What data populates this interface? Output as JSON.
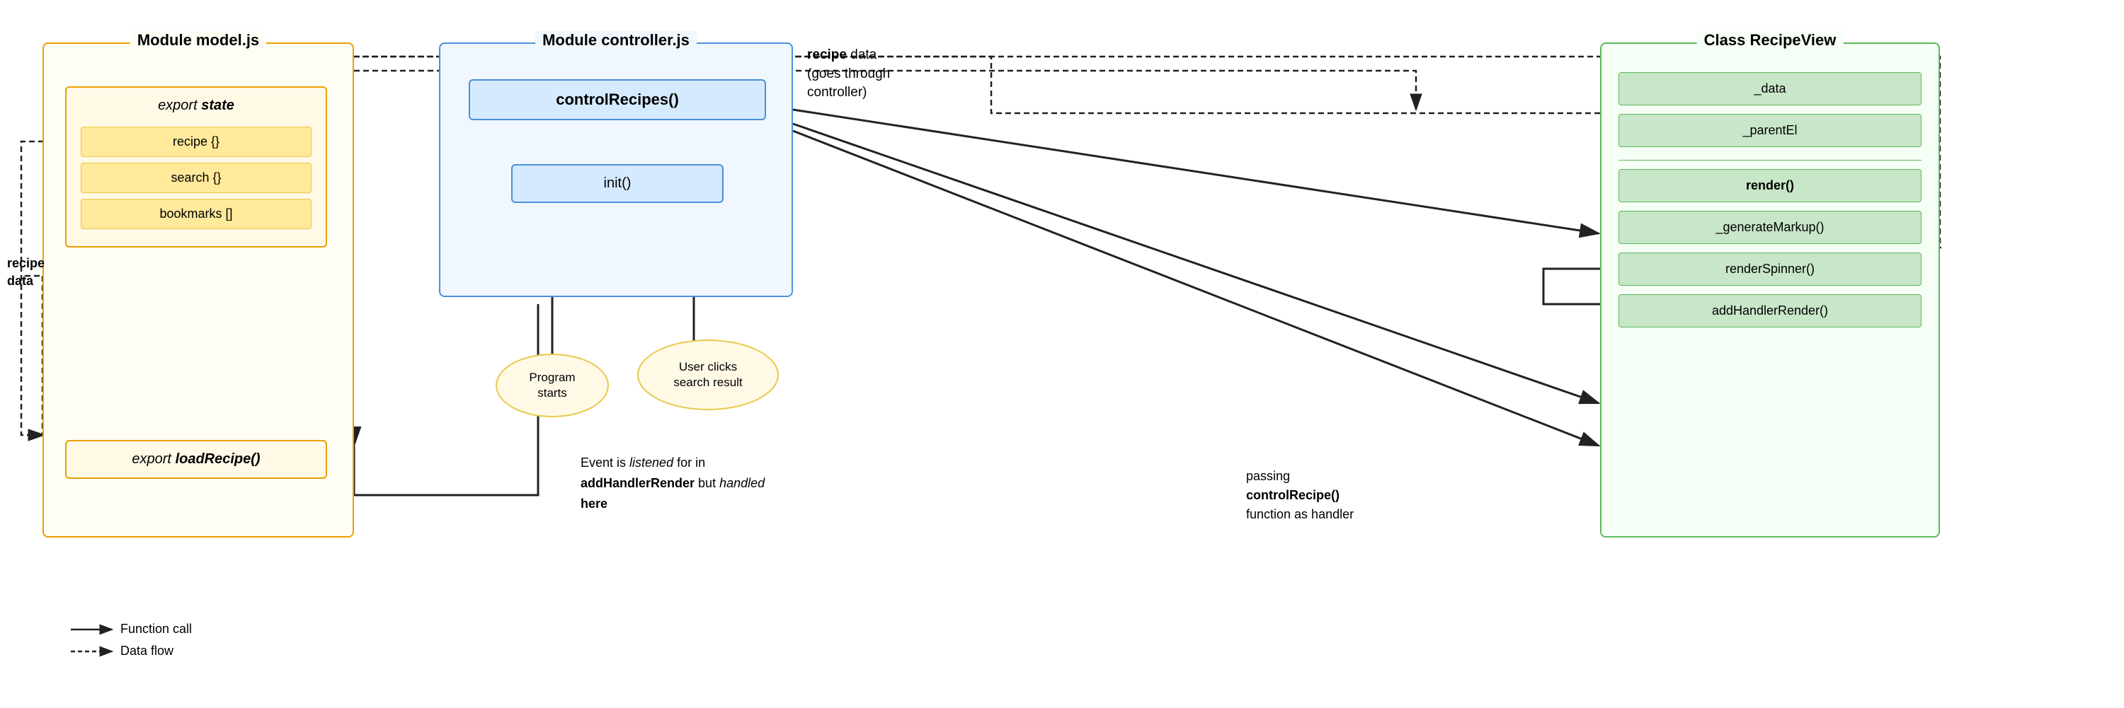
{
  "modules": {
    "model": {
      "title": "Module model.js",
      "export_state_label_italic": "export",
      "export_state_label_bold": "state",
      "state_items": [
        "recipe {}",
        "search {}",
        "bookmarks []"
      ],
      "export_load_italic": "export",
      "export_load_bold": "loadRecipe()"
    },
    "controller": {
      "title": "Module controller.js",
      "control_recipes": "controlRecipes()",
      "init": "init()"
    },
    "recipeview": {
      "title": "Class RecipeView",
      "items_top": [
        "_data",
        "_parentEl"
      ],
      "items_methods": [
        "render()",
        "_generateMarkup()",
        "renderSpinner()",
        "addHandlerRender()"
      ]
    }
  },
  "ovals": {
    "program_starts": "Program\nstarts",
    "user_clicks": "User clicks\nsearch result"
  },
  "annotations": {
    "recipe_data_left": "recipe\ndata",
    "recipe_data_right_line1": "recipe data",
    "recipe_data_right_line2": "(goes through",
    "recipe_data_right_line3": "controller)",
    "event_listened": "Event is",
    "event_listened_italic": "listened",
    "event_listened2": "for in",
    "addhandlerrender": "addHandlerRender",
    "but": "but",
    "handled_italic": "handled",
    "handled2": "here",
    "passing": "passing",
    "controlrecipe": "controlRecipe()",
    "function_as_handler": "function as handler"
  },
  "legend": {
    "function_call_label": "Function call",
    "data_flow_label": "Data flow"
  }
}
